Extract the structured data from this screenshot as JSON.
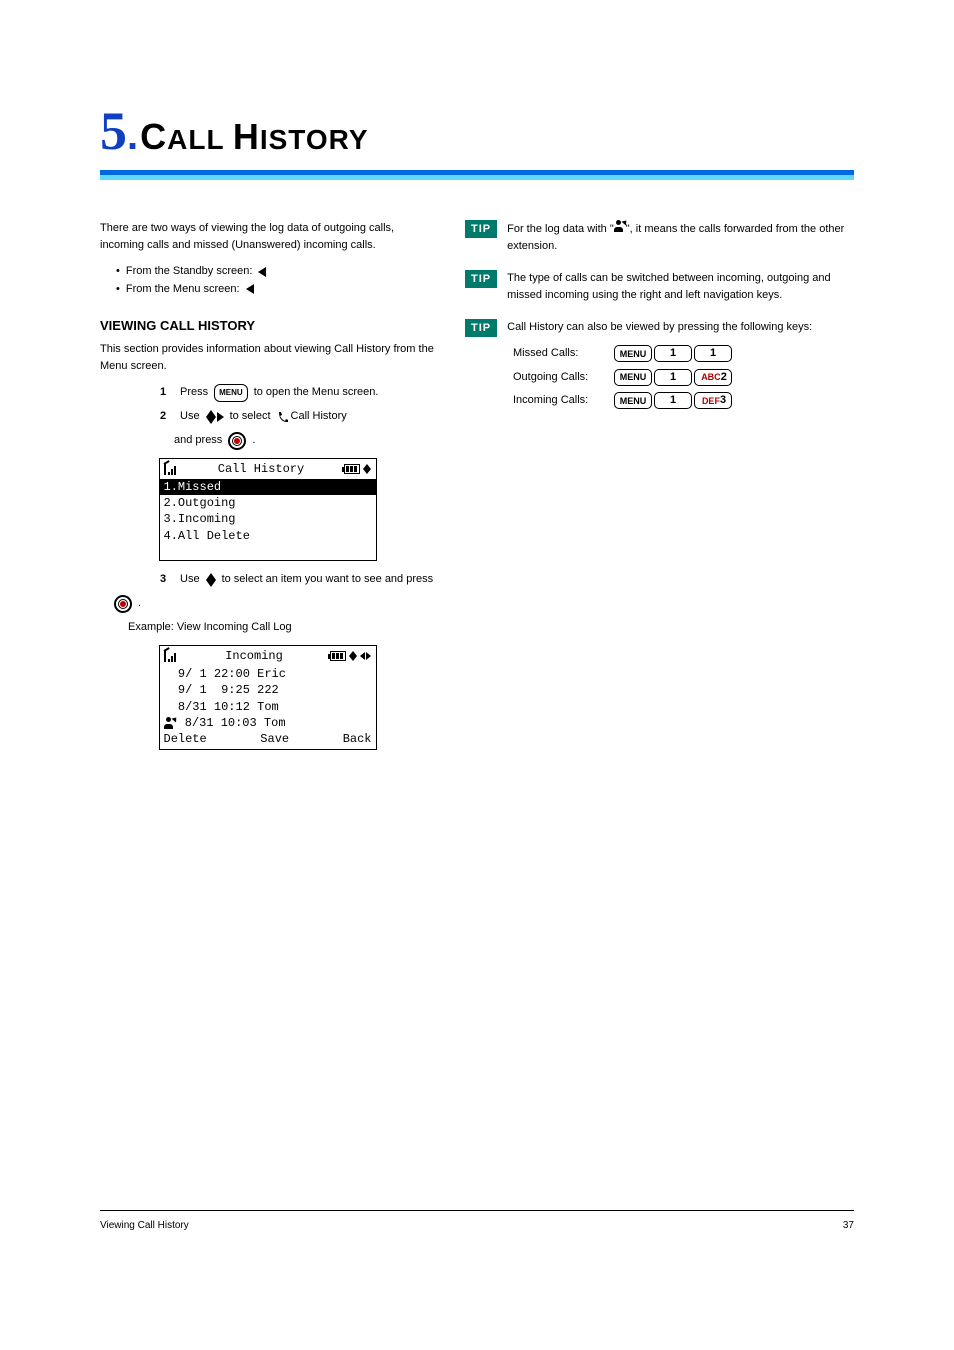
{
  "chapter": {
    "num": "5",
    "dot": ".",
    "title_caps": "C",
    "title_rest1": "ALL ",
    "title_caps2": "H",
    "title_rest2": "ISTORY"
  },
  "intro": {
    "p1": "There are two ways of viewing the log data of outgoing calls, incoming calls and missed (Unanswered) incoming calls.",
    "b1_pre": "From the Standby screen: ",
    "b2_pre": "From the Menu screen: ",
    "s_viewing": "VIEWING CALL HISTORY",
    "p2": "This section provides information about viewing Call History from the Menu screen.",
    "step1_a": "Press ",
    "step1_b": " to open the Menu screen.",
    "step2_a": "Use ",
    "step2_b": " to select ",
    "step2_c": "Call History",
    "step2_d": " and press ",
    "step2_e": ".",
    "step3_a": "Use ",
    "step3_b": " to select an item you want to see and press ",
    "step3_c": ".",
    "example_label": "Example: View Incoming Call Log"
  },
  "screen1": {
    "title": "Call History",
    "items": [
      "1.Missed",
      "2.Outgoing",
      "3.Incoming",
      "4.All Delete"
    ]
  },
  "screen2": {
    "title": "Incoming",
    "rows": [
      {
        "icon": false,
        "text": "  9/ 1 22:00 Eric",
        "sel": true
      },
      {
        "icon": false,
        "text": "  9/ 1  9:25 222",
        "sel": false
      },
      {
        "icon": false,
        "text": "  8/31 10:12 Tom",
        "sel": false
      },
      {
        "icon": true,
        "text": " 8/31 10:03 Tom",
        "sel": false
      }
    ],
    "sk_l": "Delete",
    "sk_c": "Save",
    "sk_r": "Back"
  },
  "tips": {
    "label": "TIP",
    "t1": "For the log data with \"     \", it means the calls forwarded from the other extension.",
    "t2": "The type of calls can be switched between incoming, outgoing and missed incoming using the right and left navigation keys.",
    "t3": "Call History can also be viewed by pressing the following keys:",
    "row1_label": "Missed Calls:",
    "row2_label": "Outgoing Calls:",
    "row3_label": "Incoming Calls:"
  },
  "keys": {
    "menu": "MENU",
    "d1": "1",
    "d2": "2",
    "d3": "3",
    "abc": "ABC",
    "def": "DEF"
  },
  "footer": {
    "text": "Viewing Call History",
    "page": "37"
  }
}
